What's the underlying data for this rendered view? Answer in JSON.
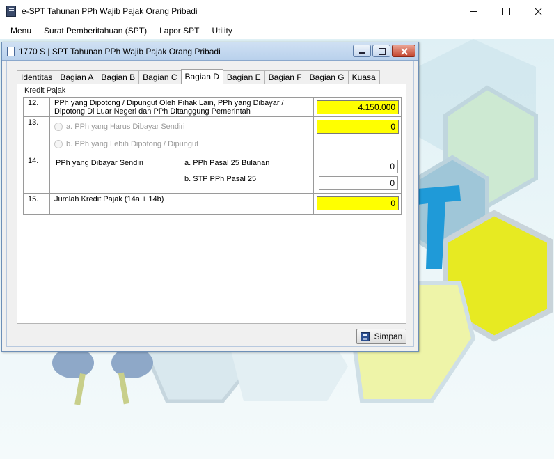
{
  "app": {
    "title": "e-SPT Tahunan PPh Wajib Pajak Orang Pribadi"
  },
  "menu": {
    "items": [
      "Menu",
      "Surat Pemberitahuan (SPT)",
      "Lapor SPT",
      "Utility"
    ]
  },
  "dialog": {
    "title": "1770 S | SPT Tahunan PPh Wajib Pajak Orang Pribadi",
    "tabs": [
      "Identitas",
      "Bagian A",
      "Bagian B",
      "Bagian C",
      "Bagian D",
      "Bagian E",
      "Bagian F",
      "Bagian G",
      "Kuasa"
    ],
    "active_tab": "Bagian D",
    "section_label": "Kredit Pajak",
    "rows": {
      "r12": {
        "num": "12.",
        "desc": "PPh yang Dipotong / Dipungut Oleh Pihak Lain, PPh yang Dibayar / Dipotong Di Luar Negeri dan PPh Ditanggung Pemerintah",
        "value": "4.150.000"
      },
      "r13": {
        "num": "13.",
        "option_a": "a. PPh yang Harus Dibayar Sendiri",
        "option_b": "b. PPh yang Lebih Dipotong / Dipungut",
        "value": "0"
      },
      "r14": {
        "num": "14.",
        "desc": "PPh yang Dibayar Sendiri",
        "sub_a_label": "a. PPh Pasal 25 Bulanan",
        "sub_a_value": "0",
        "sub_b_label": "b. STP PPh Pasal 25",
        "sub_b_value": "0"
      },
      "r15": {
        "num": "15.",
        "desc": "Jumlah Kredit Pajak (14a + 14b)",
        "value": "0"
      }
    },
    "save_label": "Simpan"
  },
  "colors": {
    "highlight_field": "#ffff00",
    "dialog_title": "#b9d1ec"
  },
  "icons": [
    "app-icon",
    "document-icon",
    "minimize-icon",
    "maximize-icon",
    "close-icon",
    "floppy-disk-icon"
  ]
}
